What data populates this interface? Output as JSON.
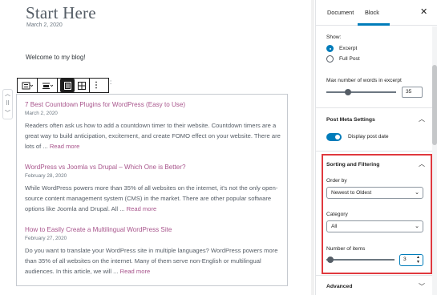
{
  "editor": {
    "page_title": "Start Here",
    "page_date": "March 2, 2020",
    "intro_text": "Welcome to my blog!",
    "toolbar_colon": ":",
    "posts": [
      {
        "title": "7 Best Countdown Plugins for WordPress (Easy to Use)",
        "date": "March 2, 2020",
        "excerpt": "Readers often ask us how to add a countdown timer to their website. Countdown timers are a great way to build anticipation, excitement, and create FOMO effect on your website. There are lots of ...",
        "read_more": "Read more"
      },
      {
        "title": "WordPress vs Joomla vs Drupal – Which One is Better?",
        "date": "February 28, 2020",
        "excerpt": "While WordPress powers more than 35% of all websites on the internet, it's not the only open-source content management system (CMS) in the market. There are other popular software options like Joomla and Drupal. All ...",
        "read_more": "Read more"
      },
      {
        "title": "How to Easily Create a Multilingual WordPress Site",
        "date": "February 27, 2020",
        "excerpt": "Do you want to translate your WordPress site in multiple languages? WordPress powers more than 35% of all websites on the internet. Many of them serve non-English or multilingual audiences. In this article, we will ...",
        "read_more": "Read more"
      }
    ]
  },
  "sidebar": {
    "tabs": [
      "Document",
      "Block"
    ],
    "active_tab": "Block",
    "close_icon": "close-icon",
    "show_label": "Show:",
    "show_options": [
      {
        "label": "Excerpt",
        "selected": true
      },
      {
        "label": "Full Post",
        "selected": false
      }
    ],
    "max_words_label": "Max number of words in excerpt",
    "max_words_value": "35",
    "post_meta": {
      "title": "Post Meta Settings",
      "display_date_label": "Display post date",
      "display_date_on": true
    },
    "sorting": {
      "title": "Sorting and Filtering",
      "order_by_label": "Order by",
      "order_by_value": "Newest to Oldest",
      "category_label": "Category",
      "category_value": "All",
      "num_items_label": "Number of items",
      "num_items_value": "3"
    },
    "advanced_title": "Advanced"
  },
  "colors": {
    "accent": "#007cba",
    "link": "#a8558c",
    "highlight": "#e0393e"
  }
}
